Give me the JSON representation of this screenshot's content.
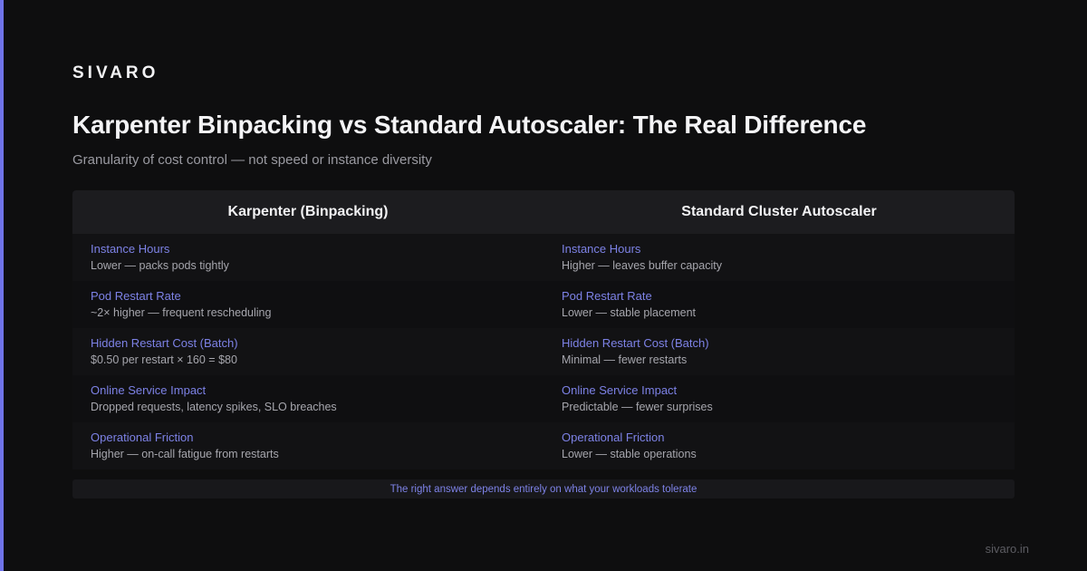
{
  "brand": "SIVARO",
  "title": "Karpenter Binpacking vs Standard Autoscaler: The Real Difference",
  "subtitle": "Granularity of cost control — not speed or instance diversity",
  "columns": [
    "Karpenter (Binpacking)",
    "Standard Cluster Autoscaler"
  ],
  "rows": [
    {
      "left_label": "Instance Hours",
      "left_value": "Lower — packs pods tightly",
      "right_label": "Instance Hours",
      "right_value": "Higher — leaves buffer capacity"
    },
    {
      "left_label": "Pod Restart Rate",
      "left_value": "~2× higher — frequent rescheduling",
      "right_label": "Pod Restart Rate",
      "right_value": "Lower — stable placement"
    },
    {
      "left_label": "Hidden Restart Cost (Batch)",
      "left_value": "$0.50 per restart × 160 = $80",
      "right_label": "Hidden Restart Cost (Batch)",
      "right_value": "Minimal — fewer restarts"
    },
    {
      "left_label": "Online Service Impact",
      "left_value": "Dropped requests, latency spikes, SLO breaches",
      "right_label": "Online Service Impact",
      "right_value": "Predictable — fewer surprises"
    },
    {
      "left_label": "Operational Friction",
      "left_value": "Higher — on-call fatigue from restarts",
      "right_label": "Operational Friction",
      "right_value": "Lower — stable operations"
    }
  ],
  "footer_note": "The right answer depends entirely on what your workloads tolerate",
  "site": "sivaro.in",
  "colors": {
    "background": "#0e0e0f",
    "accent": "#6f73e8",
    "label": "#7d82e6",
    "header_bg": "#1c1c1f"
  }
}
